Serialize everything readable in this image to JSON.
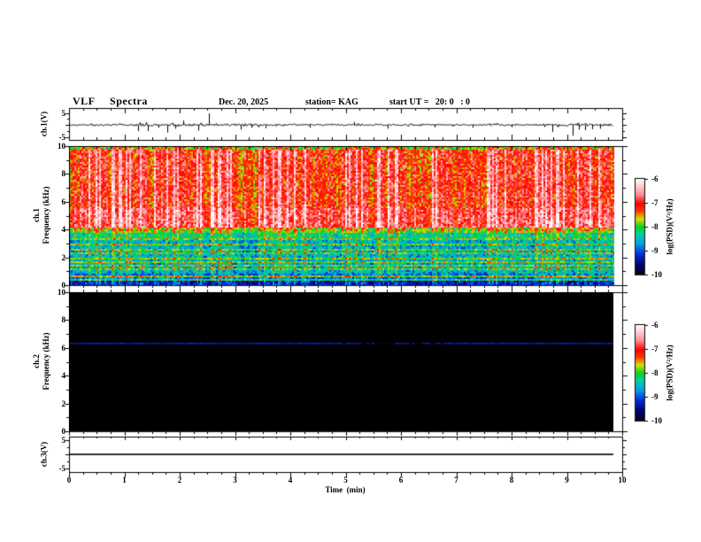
{
  "header": {
    "title": "VLF  Spectra",
    "date": "Dec. 20, 2025",
    "station": "station= KAG",
    "start_ut": "start UT =   20: 0   : 0"
  },
  "axes": {
    "time_label": "Time  (min)",
    "time_ticks": [
      "0",
      "1",
      "2",
      "3",
      "4",
      "5",
      "6",
      "7",
      "8",
      "9",
      "10"
    ],
    "ch1_wave": {
      "ylabel": "ch.1(V)",
      "yticks": [
        "5",
        "-5"
      ],
      "ytick_values": [
        5,
        -5
      ]
    },
    "ch1_spec": {
      "ylabel_line1": "ch.1",
      "ylabel_line2": "Frequency  (kHz)",
      "yticks": [
        "0",
        "2",
        "4",
        "6",
        "8",
        "10"
      ],
      "ytick_values": [
        0,
        2,
        4,
        6,
        8,
        10
      ]
    },
    "ch2_spec": {
      "ylabel_line1": "ch.2",
      "ylabel_line2": "Frequency  (kHz)",
      "yticks": [
        "0",
        "2",
        "4",
        "6",
        "8",
        "10"
      ],
      "ytick_values": [
        0,
        2,
        4,
        6,
        8,
        10
      ]
    },
    "ch3_wave": {
      "ylabel": "ch.3(V)",
      "yticks": [
        "5",
        "-5"
      ],
      "ytick_values": [
        5,
        -5
      ]
    }
  },
  "colorbar": {
    "label": "log(PSD)(V²/Hz)",
    "ticks": [
      "-6",
      "-7",
      "-8",
      "-9",
      "-10"
    ],
    "tick_values": [
      -6,
      -7,
      -8,
      -9,
      -10
    ],
    "stops": [
      [
        1,
        "#ffffff"
      ],
      [
        0.84,
        "#ff9098"
      ],
      [
        0.74,
        "#ff0000"
      ],
      [
        0.66,
        "#ff4000"
      ],
      [
        0.58,
        "#d0e000"
      ],
      [
        0.5,
        "#10d020"
      ],
      [
        0.42,
        "#00d0a0"
      ],
      [
        0.32,
        "#00a0e8"
      ],
      [
        0.22,
        "#0030e0"
      ],
      [
        0.1,
        "#000070"
      ],
      [
        0,
        "#000010"
      ]
    ]
  },
  "chart_data": [
    {
      "type": "line",
      "panel": "ch1_waveform",
      "unit": "V",
      "ylim": [
        -5,
        5
      ],
      "t_range_min": [
        0,
        9.84
      ],
      "baseline_v": 0,
      "noise_amp_v": 0.3,
      "busy_intervals_min": [
        [
          0.9,
          3.6
        ],
        [
          8.4,
          9.84
        ]
      ],
      "spikes": [
        {
          "t": 1.24,
          "v": -2.6
        },
        {
          "t": 1.42,
          "v": -2.6
        },
        {
          "t": 1.62,
          "v": -1.2
        },
        {
          "t": 1.77,
          "v": -3.2
        },
        {
          "t": 1.92,
          "v": -1.6
        },
        {
          "t": 2.06,
          "v": 1.8
        },
        {
          "t": 2.33,
          "v": -2.4
        },
        {
          "t": 2.52,
          "v": 4.8
        },
        {
          "t": 3.1,
          "v": -2.0
        },
        {
          "t": 3.3,
          "v": -1.2
        },
        {
          "t": 3.55,
          "v": -1.4
        },
        {
          "t": 4.35,
          "v": -1.2
        },
        {
          "t": 5.15,
          "v": 1.2
        },
        {
          "t": 5.76,
          "v": -1.6
        },
        {
          "t": 6.6,
          "v": -1.0
        },
        {
          "t": 7.3,
          "v": -1.2
        },
        {
          "t": 8.0,
          "v": -1.0
        },
        {
          "t": 8.73,
          "v": -3.0
        },
        {
          "t": 9.1,
          "v": -4.5
        },
        {
          "t": 9.22,
          "v": -2.0
        },
        {
          "t": 9.32,
          "v": -2.2
        },
        {
          "t": 9.45,
          "v": -1.8
        },
        {
          "t": 9.6,
          "v": -1.6
        }
      ]
    },
    {
      "type": "heatmap",
      "panel": "ch1_spectrogram",
      "unit": "log10 PSD (V^2/Hz)",
      "f_range_khz": [
        0,
        10
      ],
      "t_range_min": [
        0,
        9.84
      ],
      "value_range": [
        -10,
        -6
      ],
      "bands": [
        {
          "f": [
            9.75,
            10
          ],
          "psd": -8.2
        },
        {
          "f": [
            5.5,
            9.75
          ],
          "psd": -7.6
        },
        {
          "f": [
            4.2,
            5.5
          ],
          "psd": -7.35
        },
        {
          "f": [
            3.8,
            4.2
          ],
          "psd": -8.2
        },
        {
          "f": [
            3.4,
            3.8
          ],
          "psd": -8.55
        },
        {
          "f": [
            0.85,
            3.4
          ],
          "psd": -8.85
        },
        {
          "f": [
            0.5,
            0.85
          ],
          "psd": -9.15
        },
        {
          "f": [
            0,
            0.5
          ],
          "psd": -9.55
        }
      ],
      "horizontal_lines": [
        {
          "f_khz": 3.35,
          "psd_boost": 0.7
        },
        {
          "f_khz": 2.95,
          "psd_boost": 0.7
        },
        {
          "f_khz": 2.6,
          "psd_boost": 0.7
        },
        {
          "f_khz": 2.25,
          "psd_boost": 0.7
        },
        {
          "f_khz": 1.95,
          "psd_boost": 0.7
        },
        {
          "f_khz": 1.65,
          "psd_boost": 0.7
        },
        {
          "f_khz": 1.35,
          "psd_boost": 0.7
        },
        {
          "f_khz": 1.1,
          "psd_boost": 0.7
        },
        {
          "f_khz": 0.65,
          "psd_boost": 1.1
        },
        {
          "f_khz": 0.4,
          "psd_boost": 1.1
        }
      ],
      "vertical_streaks": {
        "strong_fraction": 0.18,
        "strong_psd_boost": 1.2,
        "medium_fraction": 0.27,
        "medium_psd_boost": 0.7,
        "weak_fraction": 0.25,
        "weak_psd_boost": 0.32,
        "low_freq_scale": 0.55
      },
      "noise_psd": 0.4,
      "seed": 12345
    },
    {
      "type": "heatmap",
      "panel": "ch2_spectrogram",
      "unit": "log10 PSD (V^2/Hz)",
      "f_range_khz": [
        0,
        10
      ],
      "t_range_min": [
        0,
        9.84
      ],
      "value_range": [
        -10,
        -6
      ],
      "background_psd": -10,
      "background_color": "#000000",
      "lines": [
        {
          "f_khz": 6.35,
          "color": "#1420e6",
          "gap_interval_min": [
            4.9,
            6.9
          ]
        }
      ],
      "seed": 777
    },
    {
      "type": "line",
      "panel": "ch3_waveform",
      "unit": "V",
      "ylim": [
        -5,
        5
      ],
      "t_range_min": [
        0,
        9.84
      ],
      "constant_v": 0
    }
  ]
}
